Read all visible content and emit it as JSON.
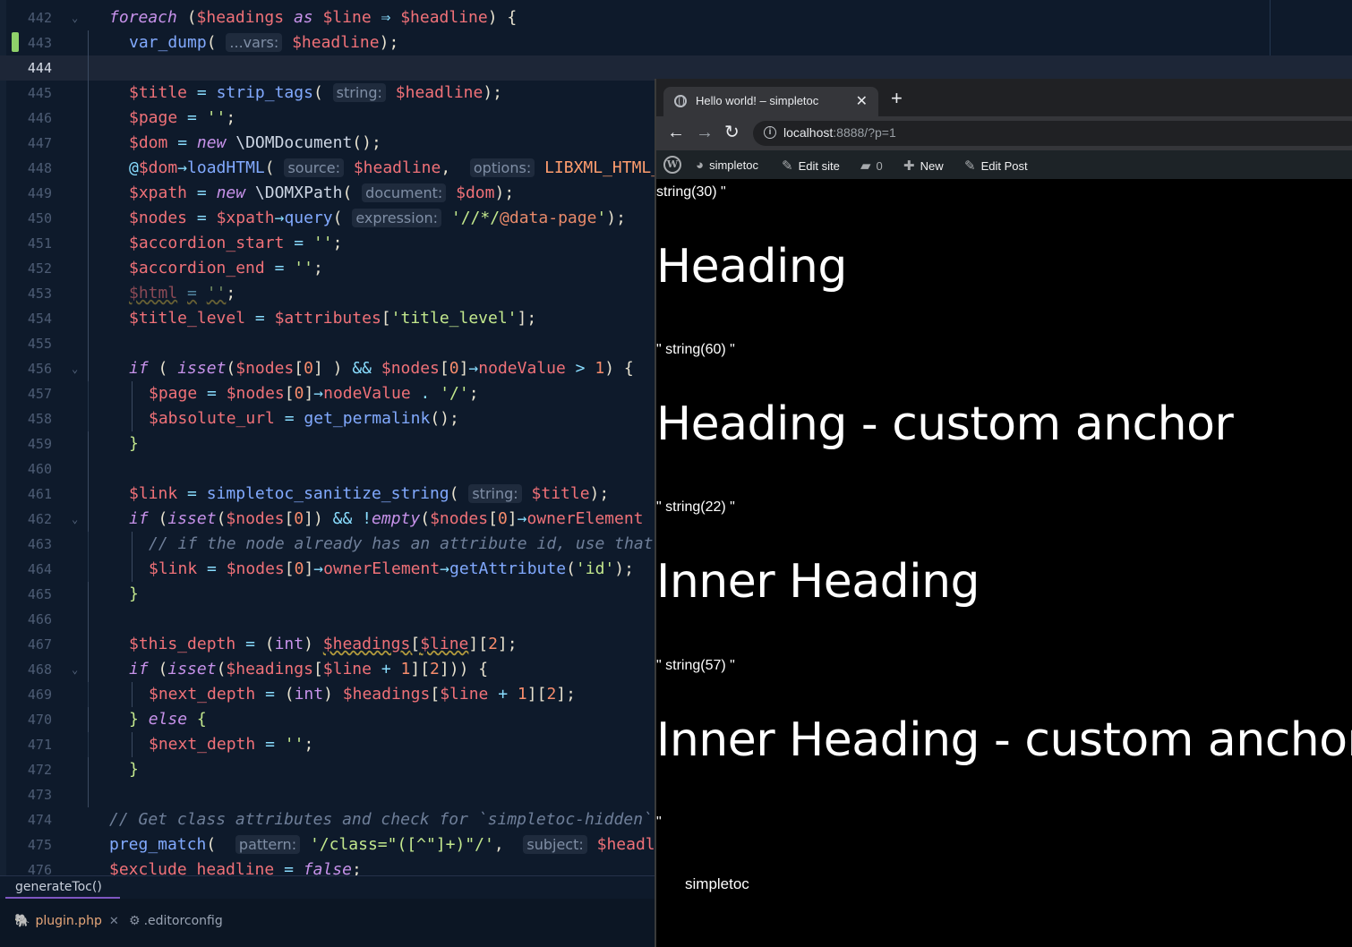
{
  "editor": {
    "lines": [
      {
        "n": "442",
        "fold": true,
        "indent": 0,
        "html": "<span class='kw'>foreach</span> <span class='p'>(</span><span class='v'>$headings</span> <span class='kw'>as</span> <span class='v'>$line</span> <span class='op'>⇒</span> <span class='v'>$headline</span><span class='p'>) {</span>"
      },
      {
        "n": "443",
        "mod": true,
        "indent": 1,
        "html": "<span class='fn'>var_dump</span><span class='p'>(</span> <span class='hint'>...vars:</span> <span class='v'>$headline</span><span class='p'>);</span>"
      },
      {
        "n": "444",
        "current": true,
        "indent": 1,
        "html": ""
      },
      {
        "n": "445",
        "indent": 1,
        "html": "<span class='v'>$title</span> <span class='op'>=</span> <span class='fn'>strip_tags</span><span class='p'>(</span> <span class='hint'>string:</span> <span class='v'>$headline</span><span class='p'>);</span>"
      },
      {
        "n": "446",
        "indent": 1,
        "html": "<span class='v'>$page</span> <span class='op'>=</span> <span class='s'>''</span><span class='p'>;</span>"
      },
      {
        "n": "447",
        "indent": 1,
        "html": "<span class='v'>$dom</span> <span class='op'>=</span> <span class='kw'>new</span> <span class='cls'>\\DOMDocument</span><span class='p'>();</span>"
      },
      {
        "n": "448",
        "indent": 1,
        "html": "<span class='op'>@</span><span class='v'>$dom</span><span class='op'>→</span><span class='fn'>loadHTML</span><span class='p'>(</span> <span class='hint'>source:</span> <span class='v'>$headline</span><span class='p'>,</span>  <span class='hint'>options:</span> <span class='cn'>LIBXML_HTML_NOIMPLIED</span>"
      },
      {
        "n": "449",
        "indent": 1,
        "html": "<span class='v'>$xpath</span> <span class='op'>=</span> <span class='kw'>new</span> <span class='cls'>\\DOMXPath</span><span class='p'>(</span> <span class='hint'>document:</span> <span class='v'>$dom</span><span class='p'>);</span>"
      },
      {
        "n": "450",
        "indent": 1,
        "html": "<span class='v'>$nodes</span> <span class='op'>=</span> <span class='v'>$xpath</span><span class='op'>→</span><span class='fn'>query</span><span class='p'>(</span> <span class='hint'>expression:</span> <span class='s'>'//*/</span><span class='v2'>@data-page</span><span class='s'>'</span><span class='p'>);</span>"
      },
      {
        "n": "451",
        "indent": 1,
        "html": "<span class='v'>$accordion_start</span> <span class='op'>=</span> <span class='s'>''</span><span class='p'>;</span>"
      },
      {
        "n": "452",
        "indent": 1,
        "html": "<span class='v'>$accordion_end</span> <span class='op'>=</span> <span class='s'>''</span><span class='p'>;</span>"
      },
      {
        "n": "453",
        "indent": 1,
        "html": "<span class='dim'><span class='v squig'>$html</span> <span class='op squig'>=</span> <span class='s squig'>''</span></span><span class='p'>;</span>"
      },
      {
        "n": "454",
        "indent": 1,
        "html": "<span class='v'>$title_level</span> <span class='op'>=</span> <span class='v'>$attributes</span><span class='p'>[</span><span class='s'>'title_level'</span><span class='p'>];</span>"
      },
      {
        "n": "455",
        "indent": 1,
        "html": ""
      },
      {
        "n": "456",
        "fold": true,
        "indent": 1,
        "html": "<span class='kw'>if</span> <span class='p'>(</span> <span class='kw'>isset</span><span class='p'>(</span><span class='v'>$nodes</span><span class='p'>[</span><span class='n'>0</span><span class='p'>] )</span> <span class='op'>&amp;&amp;</span> <span class='v'>$nodes</span><span class='p'>[</span><span class='n'>0</span><span class='p'>]</span><span class='op'>→</span><span class='prop'>nodeValue</span> <span class='op'>&gt;</span> <span class='n'>1</span><span class='p'>) {</span>"
      },
      {
        "n": "457",
        "indent": 2,
        "html": "<span class='v'>$page</span> <span class='op'>=</span> <span class='v'>$nodes</span><span class='p'>[</span><span class='n'>0</span><span class='p'>]</span><span class='op'>→</span><span class='prop'>nodeValue</span> <span class='op'>.</span> <span class='s'>'/'</span><span class='p'>;</span>"
      },
      {
        "n": "458",
        "indent": 2,
        "html": "<span class='v'>$absolute_url</span> <span class='op'>=</span> <span class='fn'>get_permalink</span><span class='p'>();</span>"
      },
      {
        "n": "459",
        "indent": 1,
        "html": "<span class='s'>}</span>"
      },
      {
        "n": "460",
        "indent": 1,
        "html": ""
      },
      {
        "n": "461",
        "indent": 1,
        "html": "<span class='v'>$link</span> <span class='op'>=</span> <span class='fn'>simpletoc_sanitize_string</span><span class='p'>(</span> <span class='hint'>string:</span> <span class='v'>$title</span><span class='p'>);</span>"
      },
      {
        "n": "462",
        "fold": true,
        "indent": 1,
        "html": "<span class='kw'>if</span> <span class='p'>(</span><span class='kw'>isset</span><span class='p'>(</span><span class='v'>$nodes</span><span class='p'>[</span><span class='n'>0</span><span class='p'>])</span> <span class='op'>&amp;&amp;</span> <span class='op'>!</span><span class='kw'>empty</span><span class='p'>(</span><span class='v'>$nodes</span><span class='p'>[</span><span class='n'>0</span><span class='p'>]</span><span class='op'>→</span><span class='prop'>ownerElement</span>"
      },
      {
        "n": "463",
        "indent": 2,
        "html": "<span class='c'>// if the node already has an attribute id, use that</span>"
      },
      {
        "n": "464",
        "indent": 2,
        "html": "<span class='v'>$link</span> <span class='op'>=</span> <span class='v'>$nodes</span><span class='p'>[</span><span class='n'>0</span><span class='p'>]</span><span class='op'>→</span><span class='prop'>ownerElement</span><span class='op'>→</span><span class='fn'>getAttribute</span><span class='p'>(</span><span class='s'>'id'</span><span class='p'>);</span>"
      },
      {
        "n": "465",
        "indent": 1,
        "html": "<span class='s'>}</span>"
      },
      {
        "n": "466",
        "indent": 1,
        "html": ""
      },
      {
        "n": "467",
        "indent": 1,
        "html": "<span class='v'>$this_depth</span> <span class='op'>=</span> <span class='p'>(</span><span class='kw' style='font-style:normal'>int</span><span class='p'>)</span> <span class='v squig'>$headings</span><span class='p squig'>[</span><span class='v squig'>$line</span><span class='p'>][</span><span class='n'>2</span><span class='p'>];</span>"
      },
      {
        "n": "468",
        "fold": true,
        "indent": 1,
        "html": "<span class='kw'>if</span> <span class='p'>(</span><span class='kw'>isset</span><span class='p'>(</span><span class='v'>$headings</span><span class='p'>[</span><span class='v'>$line</span> <span class='op'>+</span> <span class='n'>1</span><span class='p'>][</span><span class='n'>2</span><span class='p'>])) {</span>"
      },
      {
        "n": "469",
        "indent": 2,
        "html": "<span class='v'>$next_depth</span> <span class='op'>=</span> <span class='p'>(</span><span class='kw' style='font-style:normal'>int</span><span class='p'>)</span> <span class='v'>$headings</span><span class='p'>[</span><span class='v'>$line</span> <span class='op'>+</span> <span class='n'>1</span><span class='p'>][</span><span class='n'>2</span><span class='p'>];</span>"
      },
      {
        "n": "470",
        "indent": 1,
        "html": "<span class='s'>}</span> <span class='kw'>else</span> <span class='s'>{</span>"
      },
      {
        "n": "471",
        "indent": 2,
        "html": "<span class='v'>$next_depth</span> <span class='op'>=</span> <span class='s'>''</span><span class='p'>;</span>"
      },
      {
        "n": "472",
        "indent": 1,
        "html": "<span class='s'>}</span>"
      },
      {
        "n": "473",
        "indent": 1,
        "html": ""
      },
      {
        "n": "474",
        "indent": 0,
        "html": "<span class='c'>// Get class attributes and check for `simpletoc-hidden`</span>"
      },
      {
        "n": "475",
        "indent": 0,
        "html": "<span class='fn'>preg_match</span><span class='p'>(</span>  <span class='hint'>pattern:</span> <span class='s'>'/class=\"([^\"]+)\"/'</span><span class='p'>,</span>  <span class='hint'>subject:</span> <span class='v'>$headline</span>"
      },
      {
        "n": "476",
        "indent": 0,
        "html": "<span class='v'>$exclude_headline</span> <span class='op'>=</span> <span class='kw'>false</span><span class='p'>;</span>"
      }
    ],
    "function_breadcrumb": "generateToc()",
    "tabs": [
      {
        "label": "plugin.php",
        "icon": "php-elephant-icon"
      },
      {
        "label": ".editorconfig",
        "icon": "config-file-icon"
      }
    ]
  },
  "browser": {
    "tab_title": "Hello world! – simpletoc",
    "url_host": "localhost",
    "url_rest": ":8888/?p=1",
    "admin_bar": {
      "site_name": "simpletoc",
      "edit_site": "Edit site",
      "comments": "0",
      "new": "New",
      "edit_post": "Edit Post"
    },
    "content": [
      {
        "type": "dump",
        "text": "string(30) \""
      },
      {
        "type": "heading",
        "text": "Heading"
      },
      {
        "type": "dump",
        "text": "\" string(60) \""
      },
      {
        "type": "heading",
        "text": "Heading - custom anchor"
      },
      {
        "type": "dump",
        "text": "\" string(22) \""
      },
      {
        "type": "heading",
        "text": "Inner Heading"
      },
      {
        "type": "dump",
        "text": "\" string(57) \""
      },
      {
        "type": "heading",
        "text": "Inner Heading - custom anchor"
      },
      {
        "type": "dump",
        "text": "\""
      }
    ],
    "footer_site": "simpletoc"
  }
}
